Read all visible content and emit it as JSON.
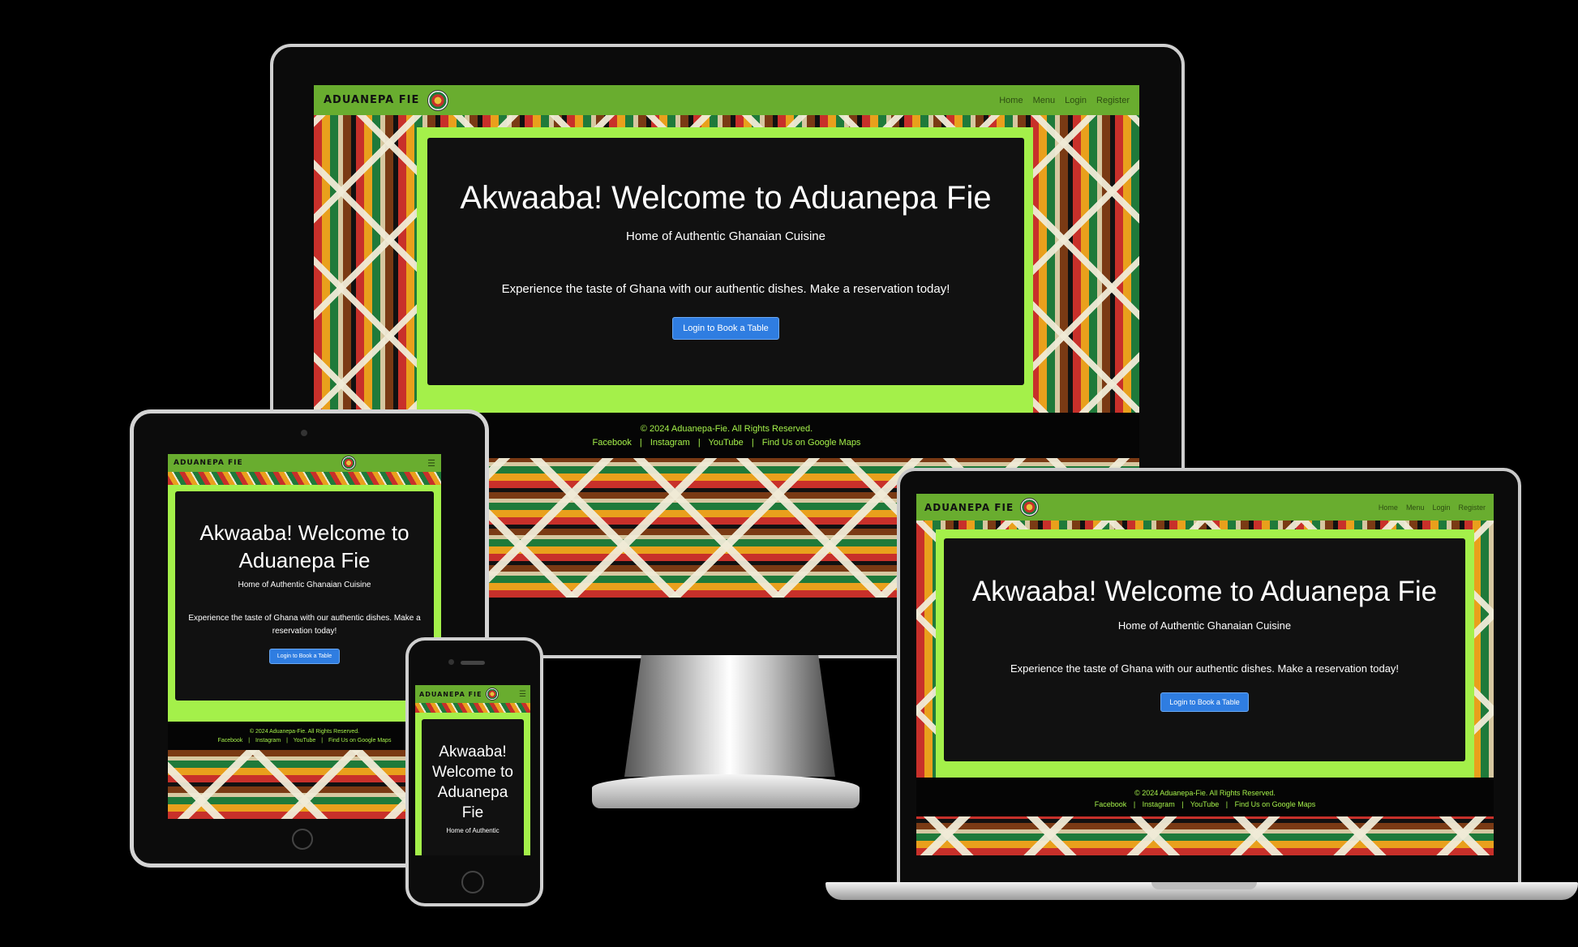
{
  "site": {
    "brand": "ADUANEPA FIE",
    "nav": [
      "Home",
      "Menu",
      "Login",
      "Register"
    ],
    "hero_title": "Akwaaba! Welcome to Aduanepa Fie",
    "hero_subtitle": "Home of Authentic Ghanaian Cuisine",
    "hero_text": "Experience the taste of Ghana with our authentic dishes. Make a reservation today!",
    "cta": "Login to Book a Table",
    "copyright": "© 2024 Aduanepa-Fie. All Rights Reserved.",
    "footer_links": [
      "Facebook",
      "Instagram",
      "YouTube",
      "Find Us on Google Maps"
    ],
    "separator": "|",
    "menu_icon": "☰",
    "phone_partial_subtitle": "Home of Authentic"
  },
  "colors": {
    "nav_green": "#69ad2f",
    "accent_green": "#a4f04a",
    "button_blue": "#2f7de1",
    "card_dark": "#111111"
  }
}
